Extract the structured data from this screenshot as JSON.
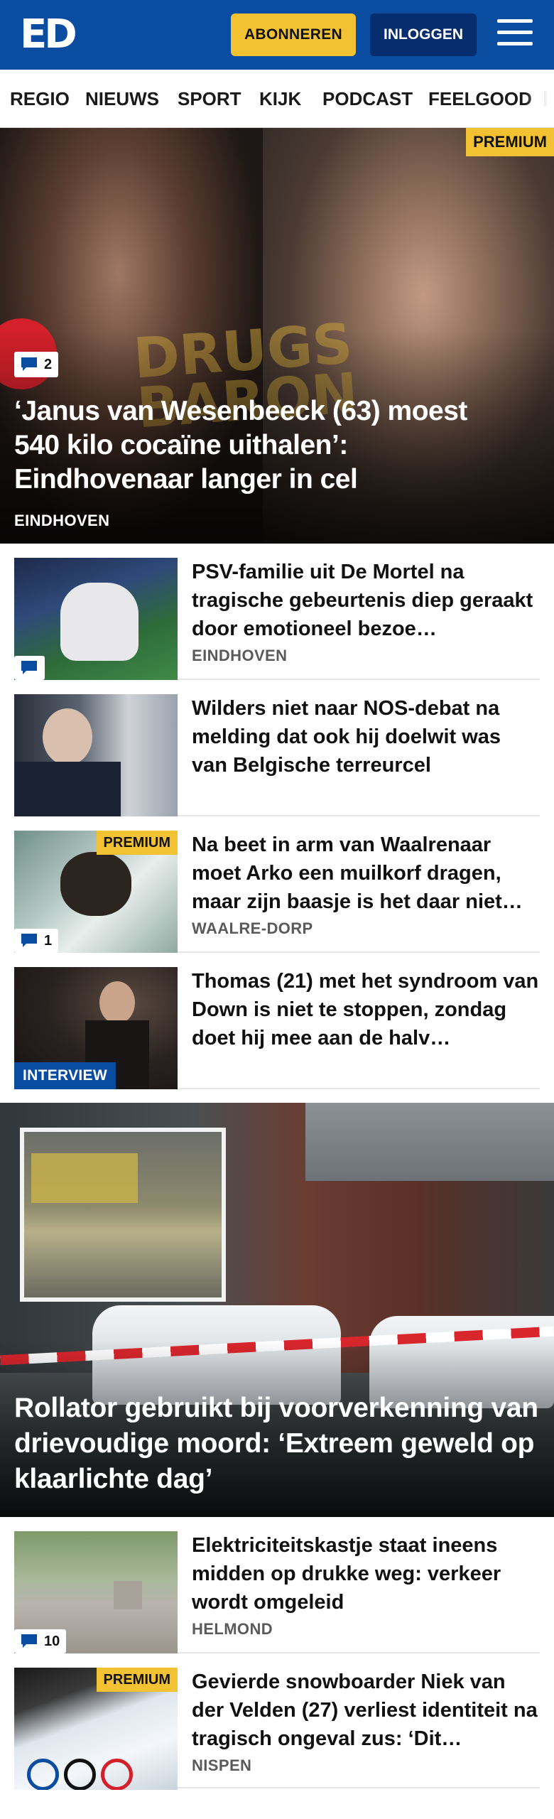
{
  "header": {
    "logo_text": "ED",
    "subscribe_label": "ABONNEREN",
    "login_label": "INLOGGEN",
    "menu_icon": "hamburger-menu-icon",
    "brand_color": "#0a4da0",
    "accent_color": "#f2c232"
  },
  "nav": {
    "items": [
      {
        "label": "REGIO"
      },
      {
        "label": "NIEUWS"
      },
      {
        "label": "SPORT"
      },
      {
        "label": "KIJK"
      },
      {
        "label": "PODCAST"
      },
      {
        "label": "FEELGOOD"
      }
    ]
  },
  "hero": {
    "premium_label": "PREMIUM",
    "book_text": "DRUGS BARON",
    "comment_count": "2",
    "title": "‘Janus van Wesenbeeck (63) moest 540 kilo cocaïne uithalen’: Eindhovenaar langer in cel",
    "location": "EINDHOVEN"
  },
  "articles": [
    {
      "title": "PSV-familie uit De Mortel na tragische gebeurtenis diep geraakt door emotioneel bezoe…",
      "location": "EINDHOVEN",
      "comment_icon": "comment-icon"
    },
    {
      "title": "Wilders niet naar NOS-debat na melding dat ook hij doelwit was van Belgische terreurcel"
    },
    {
      "title": "Na beet in arm van Waalrenaar moet Arko een muilkorf dragen, maar zijn baasje is het daar niet…",
      "location": "WAALRE-DORP",
      "premium_label": "PREMIUM",
      "comment_count": "1"
    },
    {
      "title": "Thomas (21) met het syndroom van Down is niet te stoppen, zondag doet hij mee aan de halv…",
      "tag": "INTERVIEW"
    }
  ],
  "feature": {
    "title": "Rollator gebruikt bij voorverkenning van drievoudige moord: ‘Extreem geweld op klaarlichte dag’"
  },
  "articles2": [
    {
      "title": "Elektriciteitskastje staat ineens midden op drukke weg: verkeer wordt omgeleid",
      "location": "HELMOND",
      "comment_count": "10"
    },
    {
      "title": "Gevierde snowboarder Niek van der Velden (27) verliest identiteit na tragisch ongeval zus: ‘Dit…",
      "location": "NISPEN",
      "premium_label": "PREMIUM"
    }
  ]
}
